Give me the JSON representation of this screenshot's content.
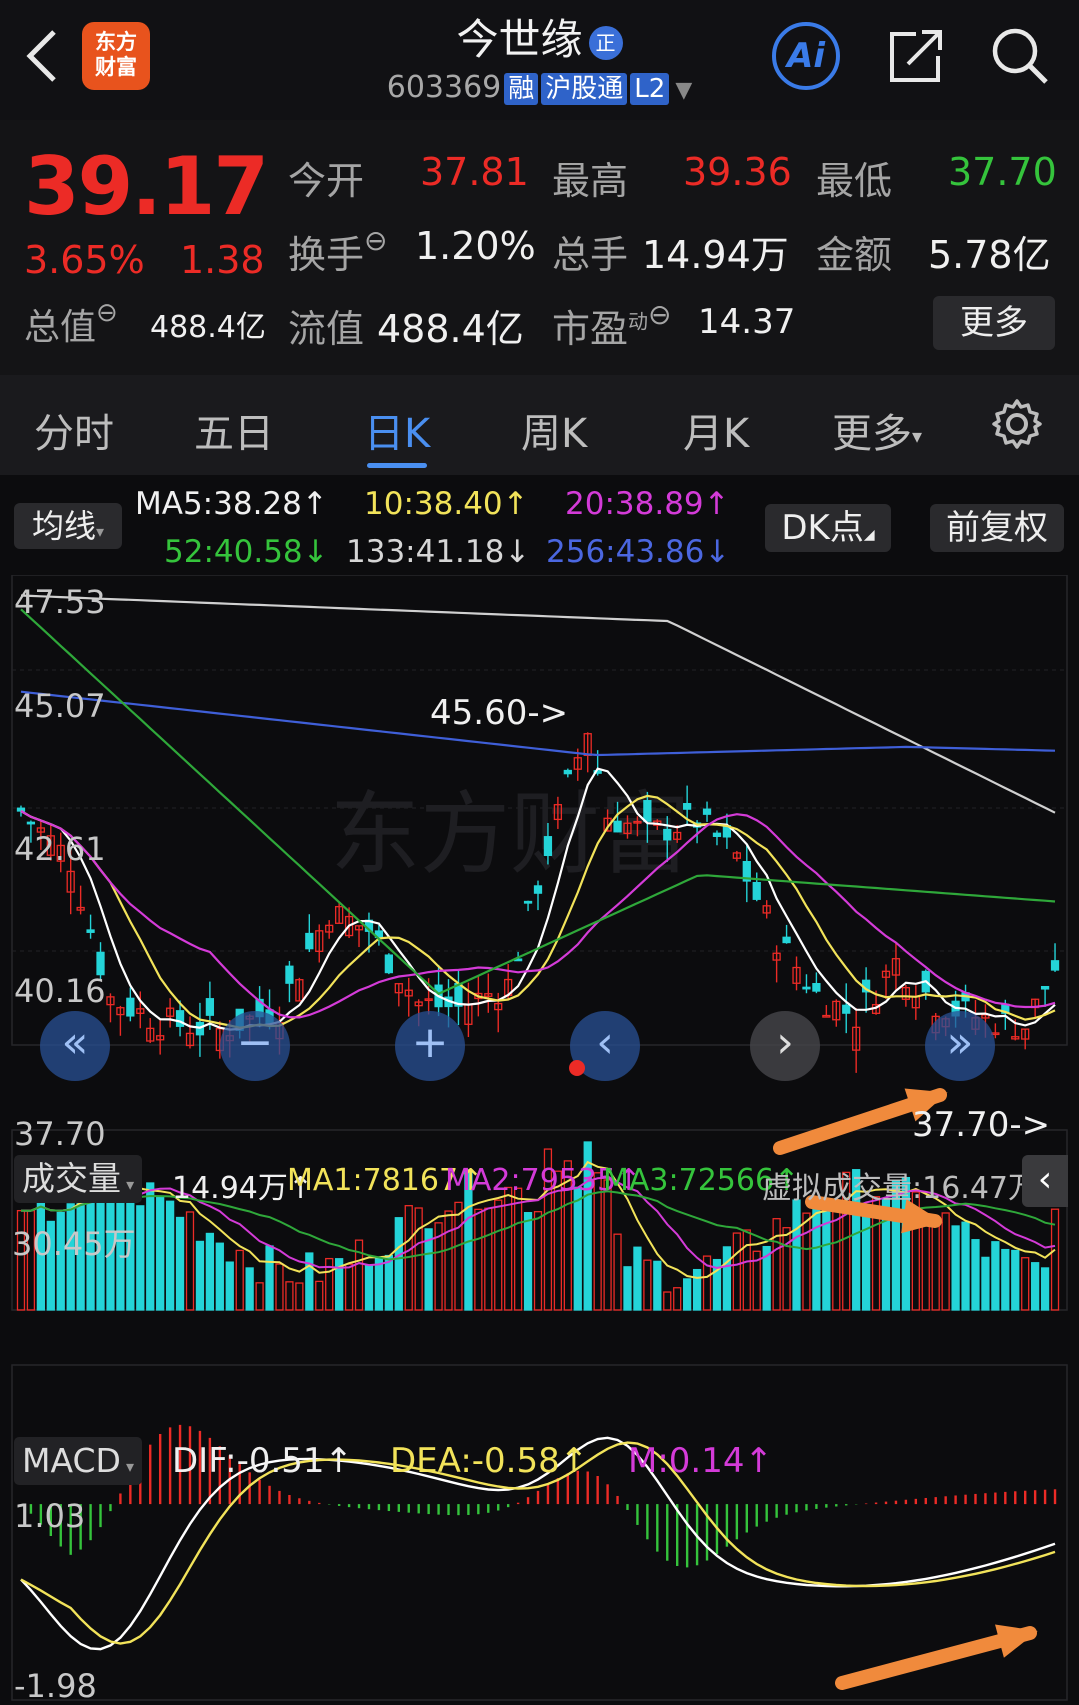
{
  "header": {
    "title": "今世缘",
    "title_badge": "正",
    "code": "603369",
    "tags": [
      "融",
      "沪股通",
      "L2"
    ],
    "logo_text_line1": "东方",
    "logo_text_line2": "财富",
    "ai_label": "Ai"
  },
  "quote": {
    "price": "39.17",
    "change_pct": "3.65%",
    "change_abs": "1.38",
    "open_label": "今开",
    "open_value": "37.81",
    "high_label": "最高",
    "high_value": "39.36",
    "low_label": "最低",
    "low_value": "37.70",
    "turnover_label": "换手",
    "turnover_value": "1.20%",
    "volume_label": "总手",
    "volume_value": "14.94万",
    "amount_label": "金额",
    "amount_value": "5.78亿",
    "total_mv_label": "总值",
    "total_mv_value": "488.4亿",
    "float_mv_label": "流值",
    "float_mv_value": "488.4亿",
    "pe_label": "市盈",
    "pe_sup": "动",
    "pe_value": "14.37",
    "more_label": "更多"
  },
  "tabs": [
    "分时",
    "五日",
    "日K",
    "周K",
    "月K",
    "更多"
  ],
  "active_tab": "日K",
  "ma_row": {
    "selector_label": "均线",
    "ma5": "MA5:38.28↑",
    "ma10": "10:38.40↑",
    "ma20": "20:38.89↑",
    "ma52": "52:40.58↓",
    "ma133": "133:41.18↓",
    "ma256": "256:43.86↓",
    "dk_label": "DK点",
    "adjust_label": "前复权"
  },
  "colors": {
    "up": "#ec2b26",
    "down": "#35c43c",
    "candle_down": "#24d4d8",
    "ma5": "#ffffff",
    "ma10": "#f2e35a",
    "ma20": "#d43bd8",
    "ma52": "#2fa83a",
    "ma133": "#d0d0d0",
    "ma256": "#3f5fd8",
    "accent": "#4a8ff0",
    "arrow": "#f08a3c"
  },
  "kline": {
    "y_labels": [
      "47.53",
      "45.07",
      "42.61",
      "40.16",
      "37.70"
    ],
    "ymax": 47.53,
    "ymin": 37.7,
    "high_annotation": "45.60->",
    "low_annotation": "37.70->"
  },
  "volume": {
    "selector_label": "成交量",
    "value": "14.94万↑",
    "ma1": "MA1:78167↑",
    "ma2": "MA2:79535↑",
    "ma3": "MA3:72566↑",
    "virtual": "虚拟成交量:16.47万",
    "y_label": "30.45万"
  },
  "macd": {
    "selector_label": "MACD",
    "dif": "DIF:-0.51↑",
    "dea": "DEA:-0.58↑",
    "m": "M:0.14↑",
    "y_top": "1.03",
    "y_bottom": "-1.98"
  }
}
